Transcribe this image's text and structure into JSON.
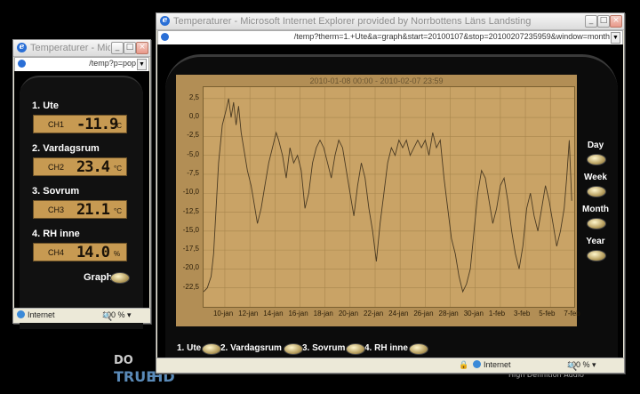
{
  "desktop": {
    "tile_text": "High Definition Audio",
    "logo_a": "DO",
    "logo_b": "TRUE",
    "logo_c": "HD"
  },
  "popup": {
    "title": "Temperaturer - Micros...",
    "url": "/temp?p=pop",
    "sensors": [
      {
        "name": "1. Ute",
        "channel": "CH1",
        "value": "-11.9",
        "unit": "°C"
      },
      {
        "name": "2. Vardagsrum",
        "channel": "CH2",
        "value": "23.4",
        "unit": "°C"
      },
      {
        "name": "3. Sovrum",
        "channel": "CH3",
        "value": "21.1",
        "unit": "°C"
      },
      {
        "name": "4. RH inne",
        "channel": "CH4",
        "value": "14.0",
        "unit": "%"
      }
    ],
    "graph_label": "Graph",
    "status_zone": "Internet",
    "zoom": "100 %"
  },
  "main": {
    "title": "Temperaturer - Microsoft Internet Explorer provided by Norrbottens Läns Landsting",
    "url": "/temp?therm=1.+Ute&a=graph&start=20100107&stop=20100207235959&window=month",
    "status_zone": "Internet",
    "zoom": "100 %",
    "periods": [
      "Day",
      "Week",
      "Month",
      "Year"
    ],
    "bottom_links": [
      "1. Ute",
      "2. Vardagsrum",
      "3. Sovrum",
      "4. RH inne"
    ]
  },
  "chart_data": {
    "type": "line",
    "title": "2010-01-08 00:00 - 2010-02-07 23:59",
    "xlabel": "",
    "ylabel": "",
    "ylim": [
      -25,
      4
    ],
    "yticks": [
      "2,5",
      "0,0",
      "-2,5",
      "-5,0",
      "-7,5",
      "-10,0",
      "-12,5",
      "-15,0",
      "-17,5",
      "-20,0",
      "-22,5"
    ],
    "xticks": [
      "10-jan",
      "12-jan",
      "14-jan",
      "16-jan",
      "18-jan",
      "20-jan",
      "22-jan",
      "24-jan",
      "26-jan",
      "28-jan",
      "30-jan",
      "1-feb",
      "3-feb",
      "5-feb",
      "7-feb"
    ],
    "grid": true,
    "series": [
      {
        "points": [
          [
            8.0,
            -23
          ],
          [
            8.3,
            -22.5
          ],
          [
            8.6,
            -21
          ],
          [
            8.8,
            -18
          ],
          [
            9.0,
            -12
          ],
          [
            9.2,
            -6
          ],
          [
            9.5,
            -1
          ],
          [
            9.8,
            1
          ],
          [
            10.0,
            2.5
          ],
          [
            10.2,
            0
          ],
          [
            10.4,
            2
          ],
          [
            10.6,
            -1
          ],
          [
            10.8,
            1.5
          ],
          [
            11.0,
            -2
          ],
          [
            11.2,
            -4
          ],
          [
            11.5,
            -7
          ],
          [
            11.8,
            -9
          ],
          [
            12.0,
            -11
          ],
          [
            12.3,
            -14
          ],
          [
            12.6,
            -12
          ],
          [
            12.9,
            -9
          ],
          [
            13.2,
            -6
          ],
          [
            13.5,
            -4
          ],
          [
            13.8,
            -2
          ],
          [
            14.0,
            -3
          ],
          [
            14.3,
            -5
          ],
          [
            14.6,
            -8
          ],
          [
            14.9,
            -4
          ],
          [
            15.2,
            -6
          ],
          [
            15.5,
            -5
          ],
          [
            15.8,
            -7
          ],
          [
            16.1,
            -12
          ],
          [
            16.4,
            -10
          ],
          [
            16.7,
            -6
          ],
          [
            17.0,
            -4
          ],
          [
            17.3,
            -3
          ],
          [
            17.6,
            -4
          ],
          [
            17.9,
            -6
          ],
          [
            18.2,
            -8
          ],
          [
            18.5,
            -5
          ],
          [
            18.8,
            -3
          ],
          [
            19.1,
            -4
          ],
          [
            19.4,
            -7
          ],
          [
            19.7,
            -10
          ],
          [
            20.0,
            -13
          ],
          [
            20.3,
            -9
          ],
          [
            20.6,
            -6
          ],
          [
            20.9,
            -8
          ],
          [
            21.2,
            -12
          ],
          [
            21.5,
            -15
          ],
          [
            21.8,
            -19
          ],
          [
            22.1,
            -14
          ],
          [
            22.4,
            -10
          ],
          [
            22.7,
            -6
          ],
          [
            23.0,
            -4
          ],
          [
            23.3,
            -5
          ],
          [
            23.6,
            -3
          ],
          [
            23.9,
            -4
          ],
          [
            24.2,
            -3
          ],
          [
            24.5,
            -5
          ],
          [
            24.8,
            -4
          ],
          [
            25.1,
            -3
          ],
          [
            25.4,
            -4
          ],
          [
            25.7,
            -3
          ],
          [
            26.0,
            -5
          ],
          [
            26.3,
            -2
          ],
          [
            26.6,
            -4
          ],
          [
            26.9,
            -3
          ],
          [
            27.2,
            -8
          ],
          [
            27.5,
            -12
          ],
          [
            27.8,
            -16
          ],
          [
            28.1,
            -18
          ],
          [
            28.4,
            -21
          ],
          [
            28.7,
            -23
          ],
          [
            29.0,
            -22
          ],
          [
            29.3,
            -20
          ],
          [
            29.6,
            -15
          ],
          [
            29.9,
            -10
          ],
          [
            30.2,
            -7
          ],
          [
            30.5,
            -8
          ],
          [
            30.8,
            -11
          ],
          [
            31.1,
            -14
          ],
          [
            31.4,
            -12
          ],
          [
            31.7,
            -9
          ],
          [
            32.0,
            -8
          ],
          [
            32.3,
            -11
          ],
          [
            32.6,
            -15
          ],
          [
            32.9,
            -18
          ],
          [
            33.2,
            -20
          ],
          [
            33.5,
            -17
          ],
          [
            33.8,
            -12
          ],
          [
            34.1,
            -10
          ],
          [
            34.4,
            -13
          ],
          [
            34.7,
            -15
          ],
          [
            35.0,
            -12
          ],
          [
            35.3,
            -9
          ],
          [
            35.6,
            -11
          ],
          [
            35.9,
            -14
          ],
          [
            36.2,
            -17
          ],
          [
            36.5,
            -15
          ],
          [
            36.8,
            -12
          ],
          [
            37.0,
            -8
          ],
          [
            37.2,
            -3
          ],
          [
            37.4,
            -11
          ]
        ]
      }
    ]
  }
}
